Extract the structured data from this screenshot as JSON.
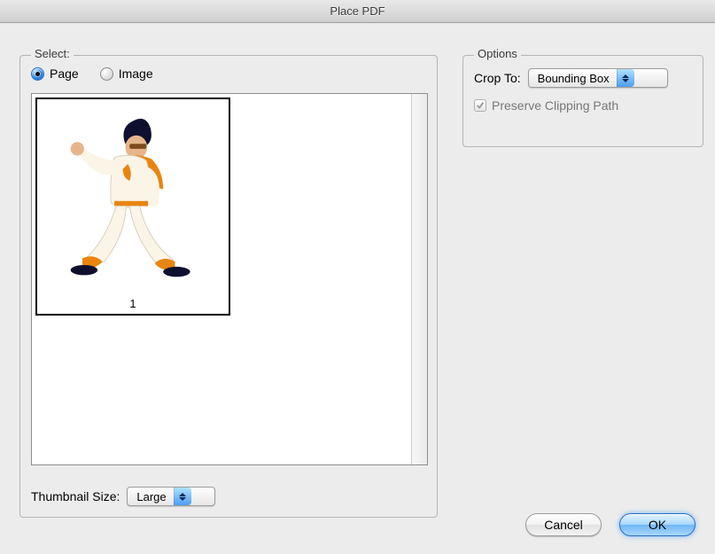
{
  "window": {
    "title": "Place PDF"
  },
  "select": {
    "legend": "Select:",
    "page_radio": "Page",
    "image_radio": "Image",
    "selected_radio": "page",
    "thumbnail": {
      "page_number": "1"
    },
    "thumbnail_size_label": "Thumbnail Size:",
    "thumbnail_size_value": "Large"
  },
  "options": {
    "legend": "Options",
    "crop_to_label": "Crop To:",
    "crop_to_value": "Bounding Box",
    "preserve_label": "Preserve Clipping Path",
    "preserve_checked": true,
    "preserve_enabled": false
  },
  "buttons": {
    "cancel": "Cancel",
    "ok": "OK"
  }
}
